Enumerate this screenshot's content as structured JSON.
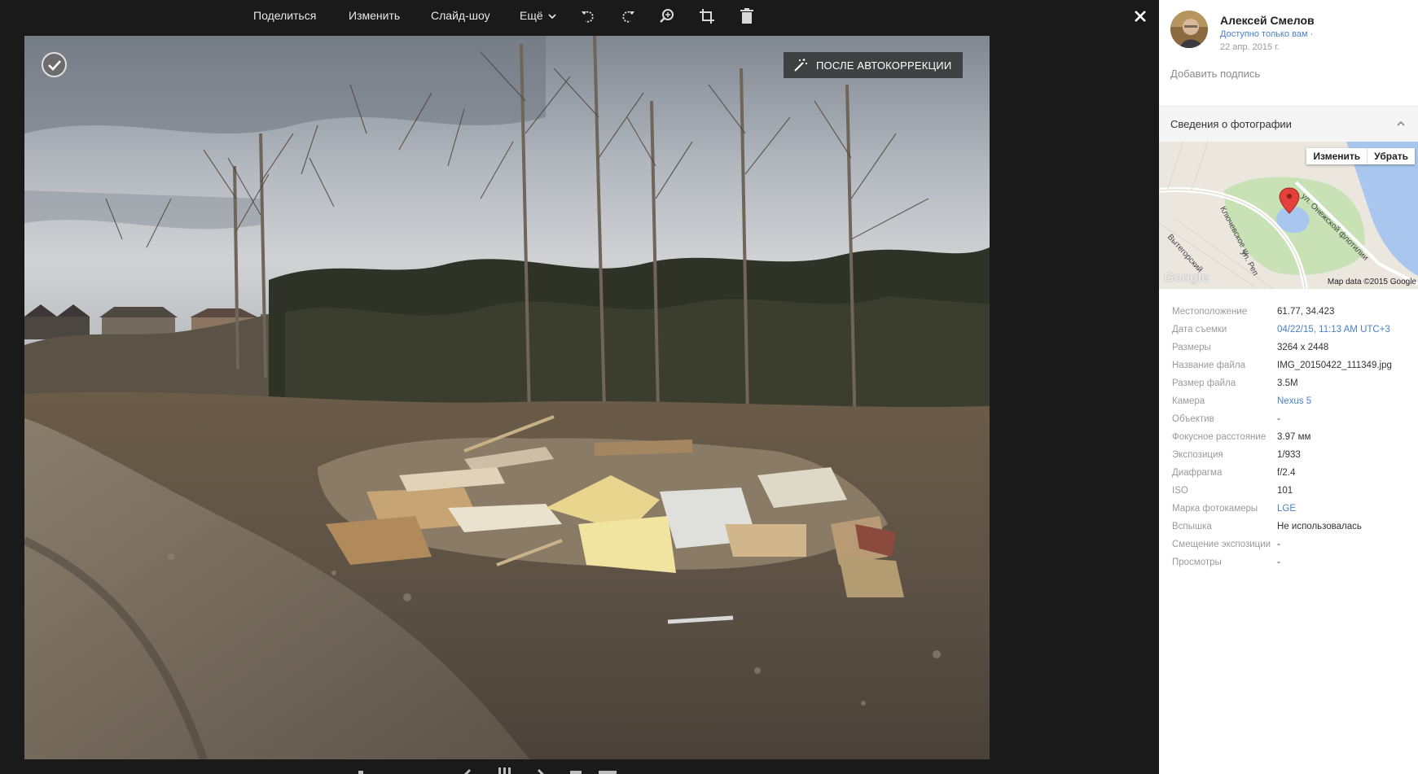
{
  "toolbar": {
    "share": "Поделиться",
    "edit": "Изменить",
    "slideshow": "Слайд-шоу",
    "more": "Ещё",
    "icons": [
      "rotate-left-icon",
      "rotate-right-icon",
      "zoom-icon",
      "crop-icon",
      "trash-icon"
    ],
    "close_icon": "close-icon"
  },
  "photo": {
    "auto_badge": "ПОСЛЕ АВТОКОРРЕКЦИИ"
  },
  "panel": {
    "owner_name": "Алексей Смелов",
    "visibility": "Доступно только вам ·",
    "date": "22 апр. 2015 г.",
    "caption_placeholder": "Добавить подпись",
    "section_title": "Сведения о фотографии",
    "map": {
      "edit_button": "Изменить",
      "remove_button": "Убрать",
      "credit": "Map data ©2015 Google",
      "logo": "Google",
      "street_labels": [
        "ул. Онежской флотилии",
        "Ключевское ш",
        "Вытегорский",
        "ул. Реп"
      ],
      "water_color": "#a9c7ee",
      "park_color": "#c8e2b6"
    },
    "details": [
      {
        "label": "Местоположение",
        "value": "61.77, 34.423",
        "link": false
      },
      {
        "label": "Дата съемки",
        "value": "04/22/15, 11:13 AM UTC+3",
        "link": true
      },
      {
        "label": "Размеры",
        "value": "3264 x 2448",
        "link": false
      },
      {
        "label": "Название файла",
        "value": "IMG_20150422_111349.jpg",
        "link": false
      },
      {
        "label": "Размер файла",
        "value": "3.5M",
        "link": false
      },
      {
        "label": "Камера",
        "value": "Nexus 5",
        "link": true
      },
      {
        "label": "Объектив",
        "value": "-",
        "link": false
      },
      {
        "label": "Фокусное расстояние",
        "value": "3.97 мм",
        "link": false
      },
      {
        "label": "Экспозиция",
        "value": "1/933",
        "link": false
      },
      {
        "label": "Диафрагма",
        "value": "f/2.4",
        "link": false
      },
      {
        "label": "ISO",
        "value": "101",
        "link": false
      },
      {
        "label": "Марка фотокамеры",
        "value": "LGE",
        "link": true
      },
      {
        "label": "Вспышка",
        "value": "Не использовалась",
        "link": false
      },
      {
        "label": "Смещение экспозиции",
        "value": "-",
        "link": false
      },
      {
        "label": "Просмотры",
        "value": "-",
        "link": false
      }
    ]
  },
  "colors": {
    "link": "#4a80c8",
    "viewer_bg": "#1a1a1a"
  }
}
